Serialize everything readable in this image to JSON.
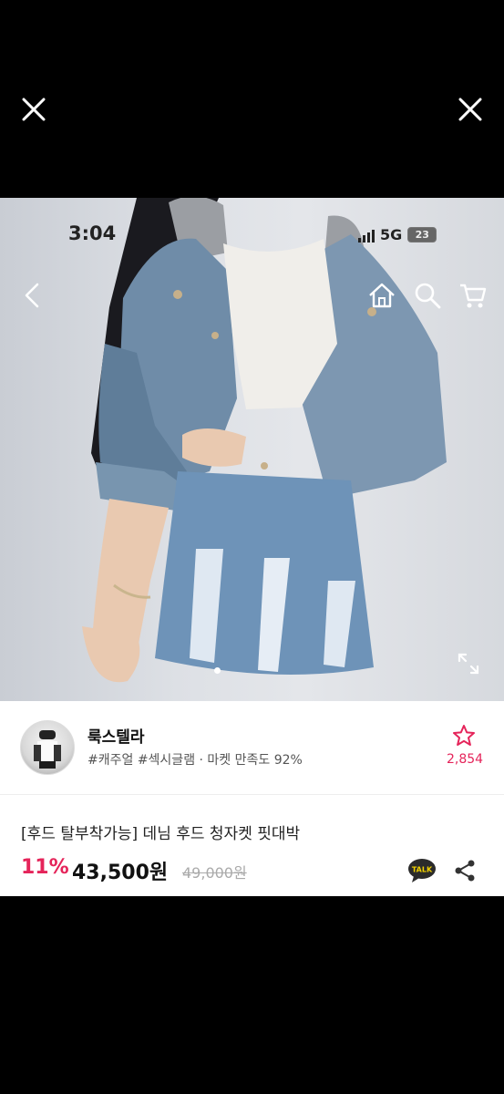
{
  "status_bar": {
    "time": "3:04",
    "network": "5G",
    "battery": "23"
  },
  "product_image": {
    "current_index": 1,
    "total": 2
  },
  "shop": {
    "name": "룩스텔라",
    "tags": "#캐주얼 #섹시글램 · 마켓 만족도 92%",
    "favorite_count": "2,854"
  },
  "product": {
    "title": "[후드 탈부착가능] 데님 후드 청자켓 핏대박",
    "discount": "11%",
    "price": "43,500원",
    "original_price": "49,000원"
  },
  "colors": {
    "accent": "#e5245a",
    "kakao": "#2b2b2b"
  }
}
